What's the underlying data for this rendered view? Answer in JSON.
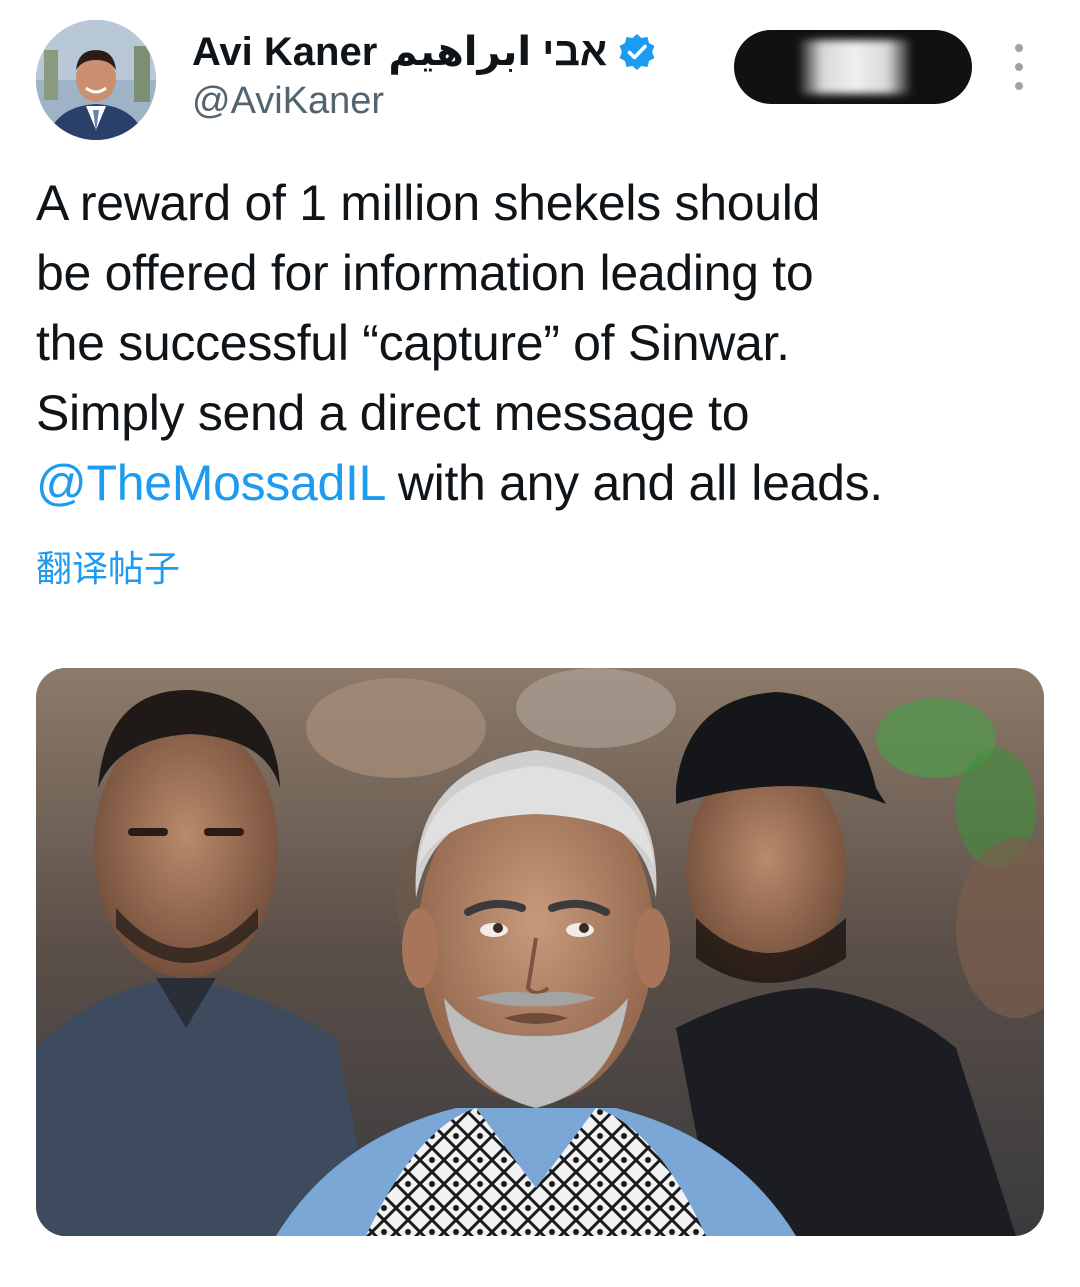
{
  "author": {
    "display_name": "Avi Kaner אבי ابراهيم",
    "handle": "@AviKaner",
    "verified": true,
    "avatar_icon": "profile-photo"
  },
  "header": {
    "subscribe_button": "redacted",
    "more_icon": "more-vertical-icon"
  },
  "tweet": {
    "lines": [
      "A reward of 1 million shekels should",
      "be offered for information leading to",
      "the successful “capture” of Sinwar.",
      "Simply send a direct message to"
    ],
    "mention": "@TheMossadIL",
    "last_line_rest": " with any and all leads."
  },
  "translate": {
    "label": "翻译帖子"
  },
  "media": {
    "type": "photo",
    "icon": "photo-image"
  },
  "colors": {
    "link": "#1d9bf0",
    "text": "#0f1419",
    "secondary": "#536471",
    "verified": "#1d9bf0"
  }
}
